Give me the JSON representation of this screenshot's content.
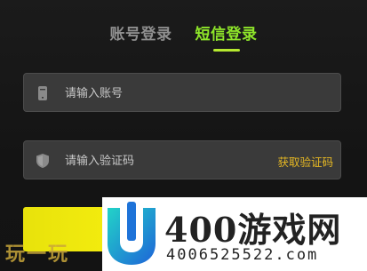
{
  "tabs": {
    "account_login": "账号登录",
    "sms_login": "短信登录"
  },
  "fields": {
    "account": {
      "placeholder": "请输入账号",
      "icon": "phone-icon"
    },
    "code": {
      "placeholder": "请输入验证码",
      "icon": "shield-icon",
      "action": "获取验证码"
    }
  },
  "submit": {
    "label": ""
  },
  "watermark": {
    "left_text": "玩一玩",
    "title": "400游戏网",
    "number": "4006525522.com"
  },
  "colors": {
    "active_tab": "#8fe62a",
    "underline": "#b5e82f",
    "get_code": "#e7b923",
    "submit_bg": "#f0ea0e"
  }
}
